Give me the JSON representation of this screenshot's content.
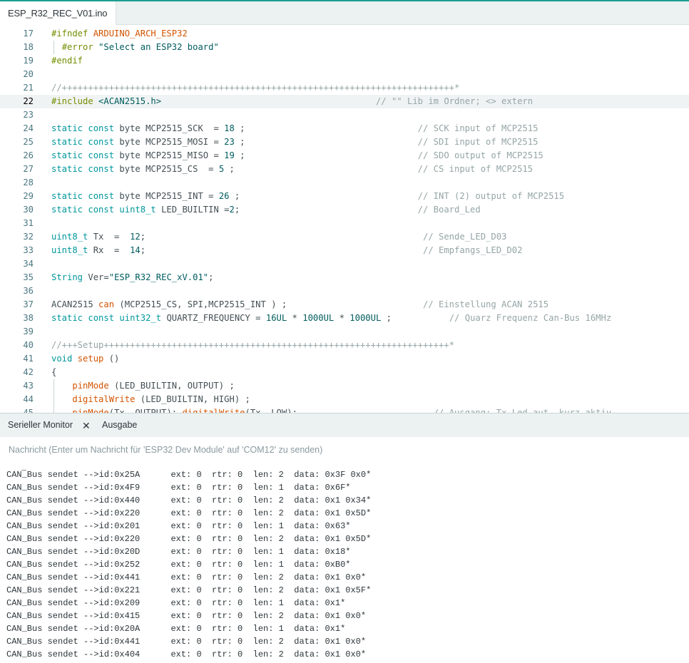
{
  "editor": {
    "file_tab": "ESP_R32_REC_V01.ino",
    "current_line": "22",
    "lines": [
      {
        "n": "17",
        "guide": false,
        "tokens": [
          [
            "pp",
            "#ifndef "
          ],
          [
            "fn",
            "ARDUINO_ARCH_ESP32"
          ]
        ]
      },
      {
        "n": "18",
        "guide": true,
        "tokens": [
          [
            "plain",
            "  "
          ],
          [
            "pp",
            "#error "
          ],
          [
            "str",
            "\"Select an ESP32 board\""
          ]
        ]
      },
      {
        "n": "19",
        "guide": false,
        "tokens": [
          [
            "pp",
            "#endif"
          ]
        ]
      },
      {
        "n": "20",
        "guide": false,
        "tokens": []
      },
      {
        "n": "21",
        "guide": false,
        "tokens": [
          [
            "cm",
            "//+++++++++++++++++++++++++++++++++++++++++++++++++++++++++++++++++++++++++++*"
          ]
        ]
      },
      {
        "n": "22",
        "guide": false,
        "tokens": [
          [
            "pp",
            "#include "
          ],
          [
            "str",
            "<ACAN2515.h>"
          ],
          [
            "plain",
            "                                         "
          ],
          [
            "cm",
            "// \"\" Lib im Ordner; <> extern"
          ]
        ]
      },
      {
        "n": "23",
        "guide": false,
        "tokens": []
      },
      {
        "n": "24",
        "guide": false,
        "tokens": [
          [
            "kw",
            "static const "
          ],
          [
            "plain",
            "byte MCP2515_SCK  = "
          ],
          [
            "num",
            "18"
          ],
          [
            "plain",
            " ;                                 "
          ],
          [
            "cm",
            "// SCK input of MCP2515"
          ]
        ]
      },
      {
        "n": "25",
        "guide": false,
        "tokens": [
          [
            "kw",
            "static const "
          ],
          [
            "plain",
            "byte MCP2515_MOSI = "
          ],
          [
            "num",
            "23"
          ],
          [
            "plain",
            " ;                                 "
          ],
          [
            "cm",
            "// SDI input of MCP2515"
          ]
        ]
      },
      {
        "n": "26",
        "guide": false,
        "tokens": [
          [
            "kw",
            "static const "
          ],
          [
            "plain",
            "byte MCP2515_MISO = "
          ],
          [
            "num",
            "19"
          ],
          [
            "plain",
            " ;                                 "
          ],
          [
            "cm",
            "// SDO output of MCP2515"
          ]
        ]
      },
      {
        "n": "27",
        "guide": false,
        "tokens": [
          [
            "kw",
            "static const "
          ],
          [
            "plain",
            "byte MCP2515_CS  = "
          ],
          [
            "num",
            "5"
          ],
          [
            "plain",
            " ;                                   "
          ],
          [
            "cm",
            "// CS input of MCP2515"
          ]
        ]
      },
      {
        "n": "28",
        "guide": false,
        "tokens": []
      },
      {
        "n": "29",
        "guide": false,
        "tokens": [
          [
            "kw",
            "static const "
          ],
          [
            "plain",
            "byte MCP2515_INT = "
          ],
          [
            "num",
            "26"
          ],
          [
            "plain",
            " ;                                  "
          ],
          [
            "cm",
            "// INT (2) output of MCP2515"
          ]
        ]
      },
      {
        "n": "30",
        "guide": false,
        "tokens": [
          [
            "kw",
            "static const "
          ],
          [
            "ty",
            "uint8_t "
          ],
          [
            "plain",
            "LED_BUILTIN ="
          ],
          [
            "num",
            "2"
          ],
          [
            "plain",
            ";                                  "
          ],
          [
            "cm",
            "// Board_Led"
          ]
        ]
      },
      {
        "n": "31",
        "guide": false,
        "tokens": []
      },
      {
        "n": "32",
        "guide": false,
        "tokens": [
          [
            "ty",
            "uint8_t "
          ],
          [
            "plain",
            "Tx  =  "
          ],
          [
            "num",
            "12"
          ],
          [
            "plain",
            ";                                                     "
          ],
          [
            "cm",
            "// Sende_LED_D03"
          ]
        ]
      },
      {
        "n": "33",
        "guide": false,
        "tokens": [
          [
            "ty",
            "uint8_t "
          ],
          [
            "plain",
            "Rx  =  "
          ],
          [
            "num",
            "14"
          ],
          [
            "plain",
            ";                                                     "
          ],
          [
            "cm",
            "// Empfangs_LED_D02"
          ]
        ]
      },
      {
        "n": "34",
        "guide": false,
        "tokens": []
      },
      {
        "n": "35",
        "guide": false,
        "tokens": [
          [
            "kw",
            "String "
          ],
          [
            "plain",
            "Ver="
          ],
          [
            "str",
            "\"ESP_R32_REC_xV.01\""
          ],
          [
            "plain",
            ";"
          ]
        ]
      },
      {
        "n": "36",
        "guide": false,
        "tokens": []
      },
      {
        "n": "37",
        "guide": false,
        "tokens": [
          [
            "plain",
            "ACAN2515 "
          ],
          [
            "fn",
            "can "
          ],
          [
            "plain",
            "(MCP2515_CS, SPI,MCP2515_INT ) ;                          "
          ],
          [
            "cm",
            "// Einstellung ACAN 2515"
          ]
        ]
      },
      {
        "n": "38",
        "guide": false,
        "tokens": [
          [
            "kw",
            "static const "
          ],
          [
            "ty",
            "uint32_t "
          ],
          [
            "plain",
            "QUARTZ_FREQUENCY = "
          ],
          [
            "num",
            "16UL"
          ],
          [
            "plain",
            " * "
          ],
          [
            "num",
            "1000UL"
          ],
          [
            "plain",
            " * "
          ],
          [
            "num",
            "1000UL"
          ],
          [
            "plain",
            " ;           "
          ],
          [
            "cm",
            "// Quarz Frequenz Can-Bus 16MHz"
          ]
        ]
      },
      {
        "n": "39",
        "guide": false,
        "tokens": []
      },
      {
        "n": "40",
        "guide": false,
        "tokens": [
          [
            "cm",
            "//+++Setup++++++++++++++++++++++++++++++++++++++++++++++++++++++++++++++++++*"
          ]
        ]
      },
      {
        "n": "41",
        "guide": false,
        "tokens": [
          [
            "kw",
            "void "
          ],
          [
            "fn",
            "setup "
          ],
          [
            "plain",
            "()"
          ]
        ]
      },
      {
        "n": "42",
        "guide": false,
        "tokens": [
          [
            "plain",
            "{"
          ]
        ]
      },
      {
        "n": "43",
        "guide": true,
        "tokens": [
          [
            "plain",
            "    "
          ],
          [
            "fn",
            "pinMode "
          ],
          [
            "plain",
            "(LED_BUILTIN, OUTPUT) ;"
          ]
        ]
      },
      {
        "n": "44",
        "guide": true,
        "tokens": [
          [
            "plain",
            "    "
          ],
          [
            "fn",
            "digitalWrite "
          ],
          [
            "plain",
            "(LED_BUILTIN, HIGH) ;"
          ]
        ]
      },
      {
        "n": "45",
        "guide": true,
        "tokens": [
          [
            "plain",
            "    "
          ],
          [
            "fn",
            "pinMode"
          ],
          [
            "plain",
            "(Tx, OUTPUT); "
          ],
          [
            "fn",
            "digitalWrite"
          ],
          [
            "plain",
            "(Tx, LOW);                          "
          ],
          [
            "cm",
            "// Ausgang: Tx Led aut, kurz aktiv"
          ]
        ]
      }
    ]
  },
  "panel": {
    "tabs": [
      {
        "label": "Serieller Monitor",
        "active": true
      },
      {
        "label": "Ausgabe",
        "active": false
      }
    ],
    "close_glyph": "✕",
    "message_placeholder": "Nachricht (Enter um Nachricht für 'ESP32 Dev Module' auf 'COM12' zu senden)",
    "cursor_glyph": "_"
  },
  "serial_output": [
    "CAN_Bus sendet -->id:0x25A      ext: 0  rtr: 0  len: 2  data: 0x3F 0x0*",
    "CAN_Bus sendet -->id:0x4F9      ext: 0  rtr: 0  len: 1  data: 0x6F*",
    "CAN_Bus sendet -->id:0x440      ext: 0  rtr: 0  len: 2  data: 0x1 0x34*",
    "CAN_Bus sendet -->id:0x220      ext: 0  rtr: 0  len: 2  data: 0x1 0x5D*",
    "CAN_Bus sendet -->id:0x201      ext: 0  rtr: 0  len: 1  data: 0x63*",
    "CAN_Bus sendet -->id:0x220      ext: 0  rtr: 0  len: 2  data: 0x1 0x5D*",
    "CAN_Bus sendet -->id:0x20D      ext: 0  rtr: 0  len: 1  data: 0x18*",
    "CAN_Bus sendet -->id:0x252      ext: 0  rtr: 0  len: 1  data: 0xB0*",
    "CAN_Bus sendet -->id:0x441      ext: 0  rtr: 0  len: 2  data: 0x1 0x0*",
    "CAN_Bus sendet -->id:0x221      ext: 0  rtr: 0  len: 2  data: 0x1 0x5F*",
    "CAN_Bus sendet -->id:0x209      ext: 0  rtr: 0  len: 1  data: 0x1*",
    "CAN_Bus sendet -->id:0x415      ext: 0  rtr: 0  len: 2  data: 0x1 0x0*",
    "CAN_Bus sendet -->id:0x20A      ext: 0  rtr: 0  len: 1  data: 0x1*",
    "CAN_Bus sendet -->id:0x441      ext: 0  rtr: 0  len: 2  data: 0x1 0x0*",
    "CAN_Bus sendet -->id:0x404      ext: 0  rtr: 0  len: 2  data: 0x1 0x0*"
  ]
}
